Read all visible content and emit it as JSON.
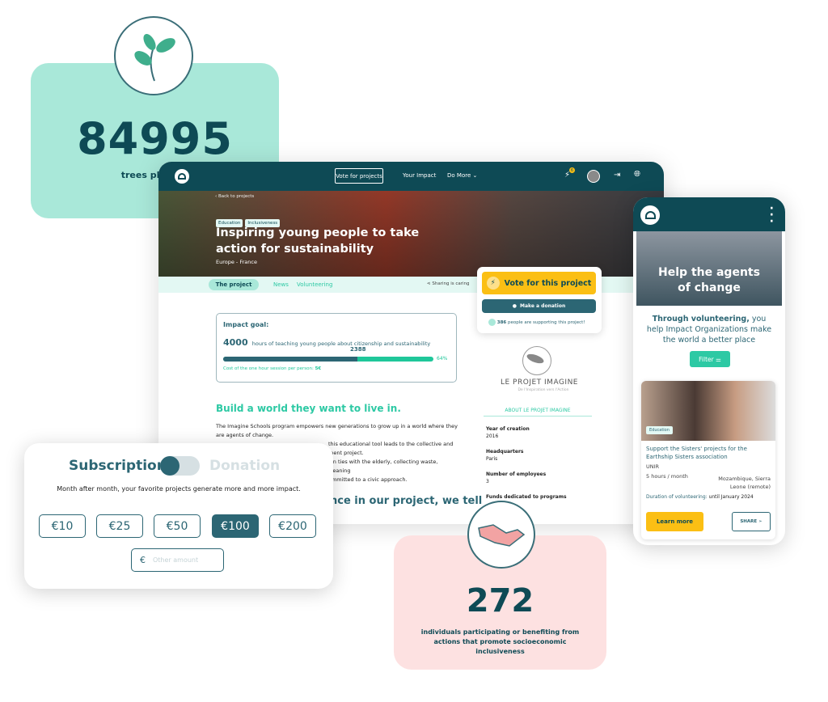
{
  "trees": {
    "value": "84995",
    "label": "trees planted",
    "icon": "leaves-icon"
  },
  "browser": {
    "nav": {
      "vote": "Vote for projects",
      "impact": "Your Impact",
      "more": "Do More ⌄",
      "badge": "6"
    },
    "hero": {
      "back": "‹  Back to projects",
      "tags": [
        "Education",
        "Inclusiveness"
      ],
      "title": "Inspiring young people to take action for sustainability",
      "location": "Europe - France"
    },
    "tabs": {
      "project": "The project",
      "news": "News",
      "volunteering": "Volunteering",
      "share": "Sharing is caring"
    },
    "impact": {
      "label": "Impact goal:",
      "goal": "4000",
      "goal_text": "hours of teaching young people about citizenship and sustainability",
      "current": "2388",
      "percent": "64%",
      "progress": 64,
      "cost_label": "Cost of the one hour session per person:",
      "cost": "5€"
    },
    "heading": "Build a world they want to live in.",
    "para1": "The Imagine Schools program empowers new generations to grow up in a world where they are agents of change.",
    "para2": "this educational tool leads to the collective and",
    "para3": "ment project.",
    "para4": "ain ties with the elderly, collecting waste, cleaning",
    "para5": "ommitted to a civic approach.",
    "heading2": "nce in our project, we tell",
    "side": {
      "vote": "Vote for this project",
      "donate": "Make a donation",
      "supporters_count": "386",
      "supporters_text": "people are supporting this project!",
      "org_name": "LE PROJET IMAGINE",
      "org_tagline": "De l'Inspiration vers l'Action",
      "about": "ABOUT LE PROJET IMAGINE",
      "facts": [
        {
          "k": "Year of creation",
          "v": "2016"
        },
        {
          "k": "Headquarters",
          "v": "Paris"
        },
        {
          "k": "Number of employees",
          "v": "3"
        },
        {
          "k": "Funds dedicated to programs",
          "v": ""
        }
      ]
    }
  },
  "donation": {
    "subscription": "Subscription",
    "donation": "Donation",
    "desc": "Month after month, your favorite projects generate more and more impact.",
    "amounts": [
      "€10",
      "€25",
      "€50",
      "€100",
      "€200"
    ],
    "selected": "€100",
    "currency": "€",
    "other_placeholder": "Other amount"
  },
  "inclusive": {
    "value": "272",
    "label": "individuals participating or benefiting from actions that promote socioeconomic inclusiveness",
    "icon": "handshake-icon"
  },
  "phone": {
    "hero": "Help the agents of change",
    "intro_bold": "Through volunteering,",
    "intro": " you help Impact Organizations make the world a better place",
    "filter": "Filter",
    "card": {
      "tag": "Education",
      "title": "Support the Sisters' projects for the Earthship Sisters association",
      "org": "UNIR",
      "time": "5 hours / month",
      "location": "Mozambique, Sierra Leone (remote)",
      "duration_label": "Duration of volunteering:",
      "duration": "until January 2024",
      "learn": "Learn more",
      "share": "SHARE"
    }
  },
  "colors": {
    "dark": "#0e4a55",
    "teal": "#2c6674",
    "accent": "#2dc9a4",
    "yellow": "#fbbf14",
    "mint": "#a9e8d9",
    "pink": "#fde1e1"
  }
}
